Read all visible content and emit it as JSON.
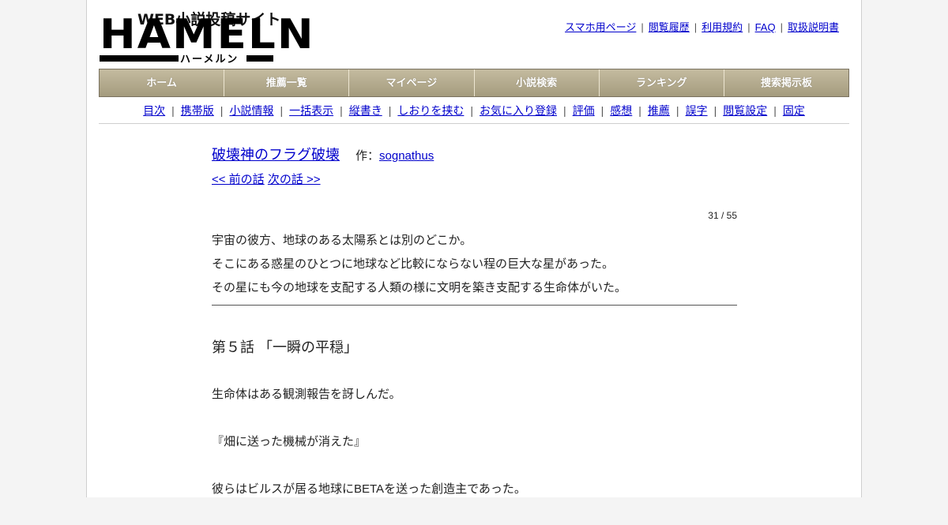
{
  "logo": {
    "tagline": "WEB小説投稿サイト",
    "name": "HAMELN",
    "kana": "ハーメルン"
  },
  "toplinks": [
    "スマホ用ページ",
    "閲覧履歴",
    "利用規約",
    "FAQ",
    "取扱説明書"
  ],
  "nav": [
    "ホーム",
    "推薦一覧",
    "マイページ",
    "小説検索",
    "ランキング",
    "捜索掲示板"
  ],
  "subnav": [
    "目次",
    "携帯版",
    "小説情報",
    "一括表示",
    "縦書き",
    "しおりを挟む",
    "お気に入り登録",
    "評価",
    "感想",
    "推薦",
    "誤字",
    "閲覧設定",
    "固定"
  ],
  "novel": {
    "title": "破壊神のフラグ破壊",
    "author_prefix": "作：",
    "author": "sognathus",
    "prev": "<< 前の話",
    "next": "次の話 >>",
    "counter": "31 / 55"
  },
  "preface": [
    "宇宙の彼方、地球のある太陽系とは別のどこか。",
    "そこにある惑星のひとつに地球など比較にならない程の巨大な星があった。",
    "その星にも今の地球を支配する人類の様に文明を築き支配する生命体がいた。"
  ],
  "chapter_title": "第５話 「一瞬の平穏」",
  "body": [
    "生命体はある観測報告を訝しんだ。",
    "『畑に送った機械が消えた』",
    "彼らはビルスが居る地球にBETAを送った創造主であった。"
  ]
}
